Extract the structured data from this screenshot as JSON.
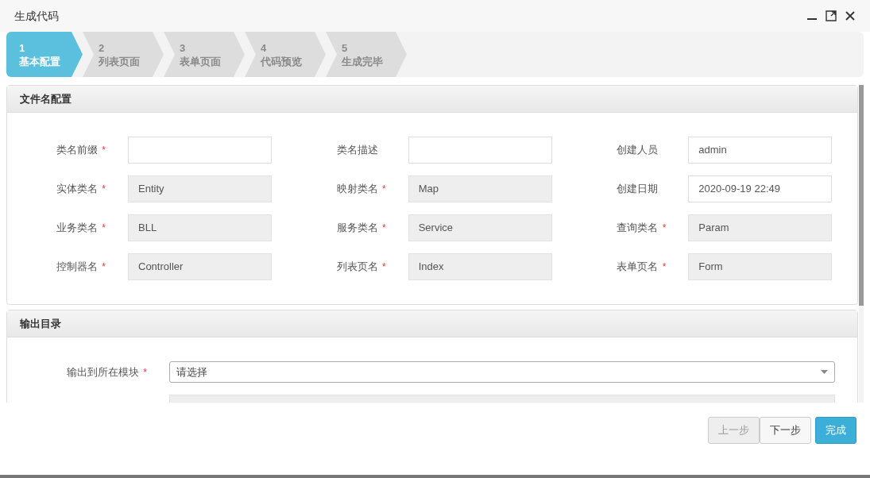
{
  "window": {
    "title": "生成代码"
  },
  "steps": [
    {
      "number": "1",
      "label": "基本配置",
      "selected": true
    },
    {
      "number": "2",
      "label": "列表页面",
      "selected": false
    },
    {
      "number": "3",
      "label": "表单页面",
      "selected": false
    },
    {
      "number": "4",
      "label": "代码预览",
      "selected": false
    },
    {
      "number": "5",
      "label": "生成完毕",
      "selected": false
    }
  ],
  "file_name_panel": {
    "title": "文件名配置",
    "fields": [
      {
        "label": "类名前缀",
        "mark": "*",
        "readonly": false
      },
      {
        "label": "类名描述",
        "readonly": false
      },
      {
        "label": "创建人员",
        "readonly": false,
        "value": "admin"
      },
      {
        "label": "实体类名",
        "mark": "*",
        "readonly": true,
        "value": "Entity"
      },
      {
        "label": "映射类名",
        "mark": "*",
        "readonly": true,
        "value": "Map"
      },
      {
        "label": "创建日期",
        "readonly": false,
        "value": "2020-09-19 22:49"
      },
      {
        "label": "业务类名",
        "mark": "*",
        "readonly": true,
        "value": "BLL"
      },
      {
        "label": "服务类名",
        "mark": "*",
        "readonly": true,
        "value": "Service"
      },
      {
        "label": "查询类名",
        "mark": "*",
        "readonly": true,
        "value": "Param"
      },
      {
        "label": "控制器名",
        "mark": "*",
        "readonly": true,
        "value": "Controller"
      },
      {
        "label": "列表页名",
        "mark": "*",
        "readonly": true,
        "value": "Index"
      },
      {
        "label": "表单页名",
        "mark": "*",
        "readonly": true,
        "value": "Form"
      }
    ]
  },
  "output_panel": {
    "title": "输出目录",
    "module": {
      "label": "输出到所在模块",
      "mark": "*",
      "value": "请选择"
    },
    "path_field": {
      "readonly": true
    }
  },
  "buttons": [
    {
      "label": "上一步",
      "kind": "default",
      "disabled": true
    },
    {
      "label": "下一步",
      "kind": "default",
      "disabled": false
    },
    {
      "label": "完成",
      "kind": "primary",
      "disabled": false
    }
  ]
}
